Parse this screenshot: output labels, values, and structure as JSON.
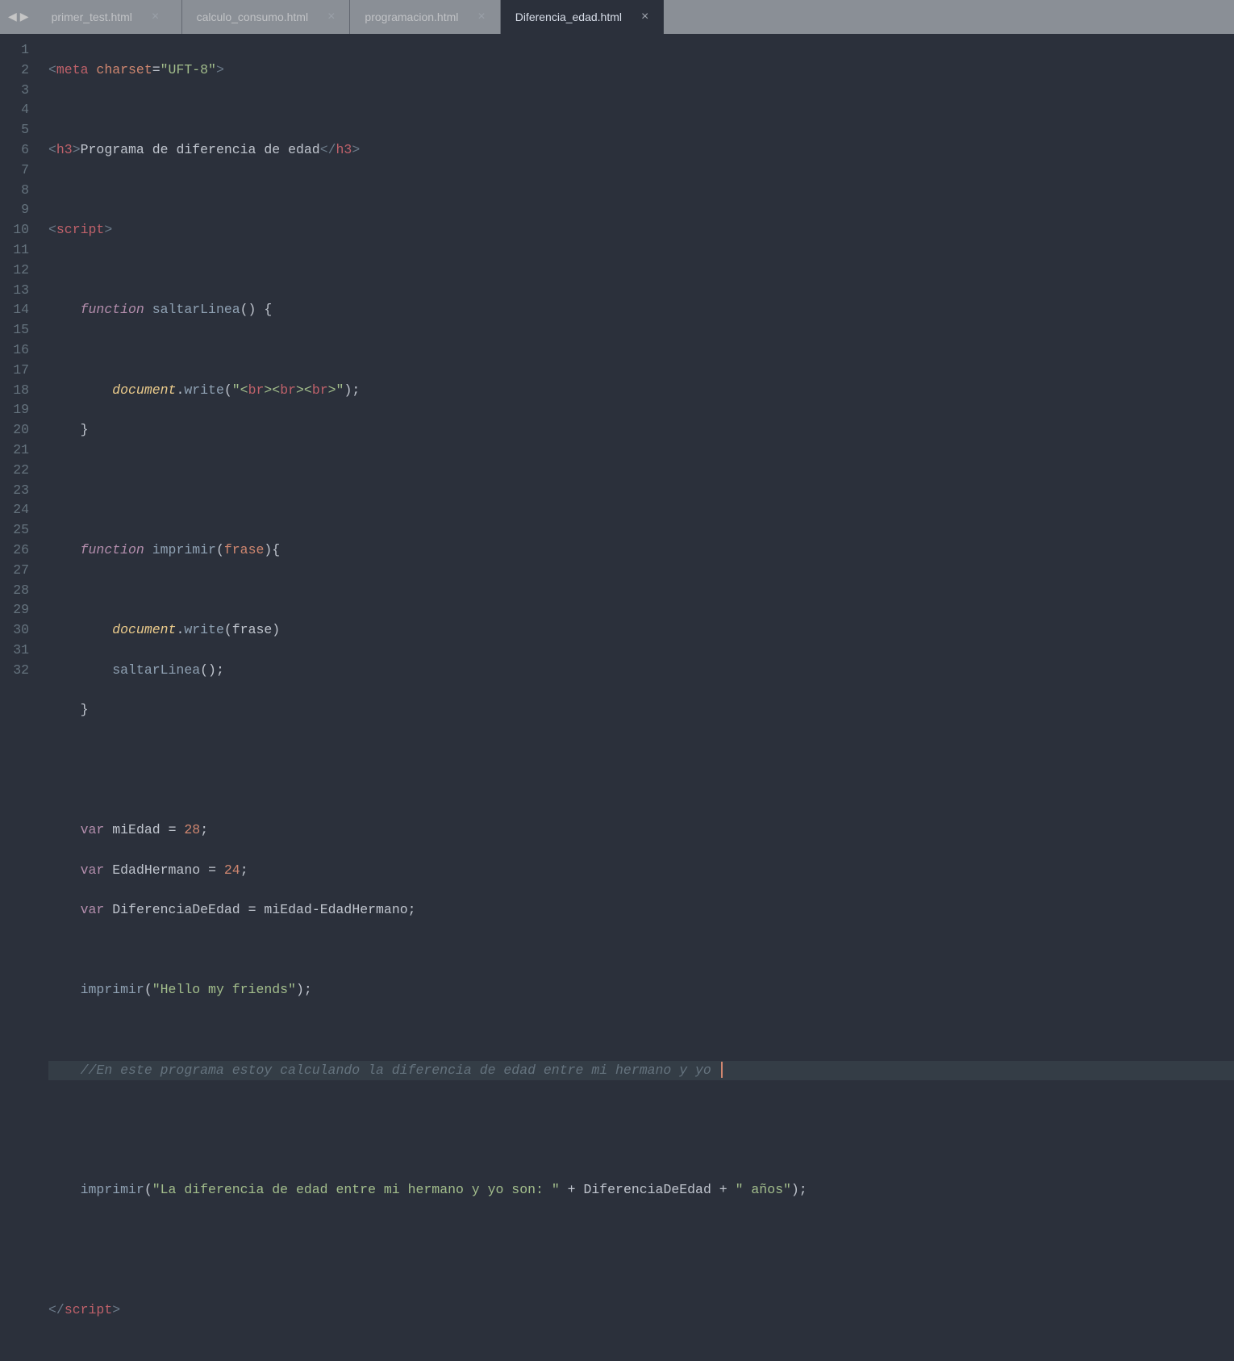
{
  "nav": {
    "back": "◀",
    "forward": "▶"
  },
  "tabs": [
    {
      "label": "primer_test.html",
      "active": false
    },
    {
      "label": "calculo_consumo.html",
      "active": false
    },
    {
      "label": "programacion.html",
      "active": false
    },
    {
      "label": "Diferencia_edad.html",
      "active": true
    }
  ],
  "close_glyph": "×",
  "gutter": {
    "start": 1,
    "end": 32
  },
  "code": {
    "l1_meta": "meta",
    "l1_charset": "charset",
    "l1_charset_val": "\"UFT-8\"",
    "l3_tag": "h3",
    "l3_text": "Programa de diferencia de edad",
    "l5_tag": "script",
    "l7_function": "function",
    "l7_name": "saltarLinea",
    "l9_doc": "document",
    "l9_write": "write",
    "l9_arg_open": "\"",
    "l9_br": "br",
    "l9_arg_close": "\"",
    "l13_function": "function",
    "l13_name": "imprimir",
    "l13_param": "frase",
    "l15_doc": "document",
    "l15_write": "write",
    "l15_arg": "frase",
    "l16_call": "saltarLinea",
    "l20_var": "var",
    "l20_name": "miEdad",
    "l20_val": "28",
    "l21_var": "var",
    "l21_name": "EdadHermano",
    "l21_val": "24",
    "l22_var": "var",
    "l22_name": "DiferenciaDeEdad",
    "l22_a": "miEdad",
    "l22_b": "EdadHermano",
    "l24_call": "imprimir",
    "l24_arg": "\"Hello my friends\"",
    "l26_comment": "//En este programa estoy calculando la diferencia de edad entre mi hermano y yo ",
    "l29_call": "imprimir",
    "l29_str1": "\"La diferencia de edad entre mi hermano y yo son: \"",
    "l29_var": "DiferenciaDeEdad",
    "l29_str2": "\" años\"",
    "l32_tag": "script"
  }
}
